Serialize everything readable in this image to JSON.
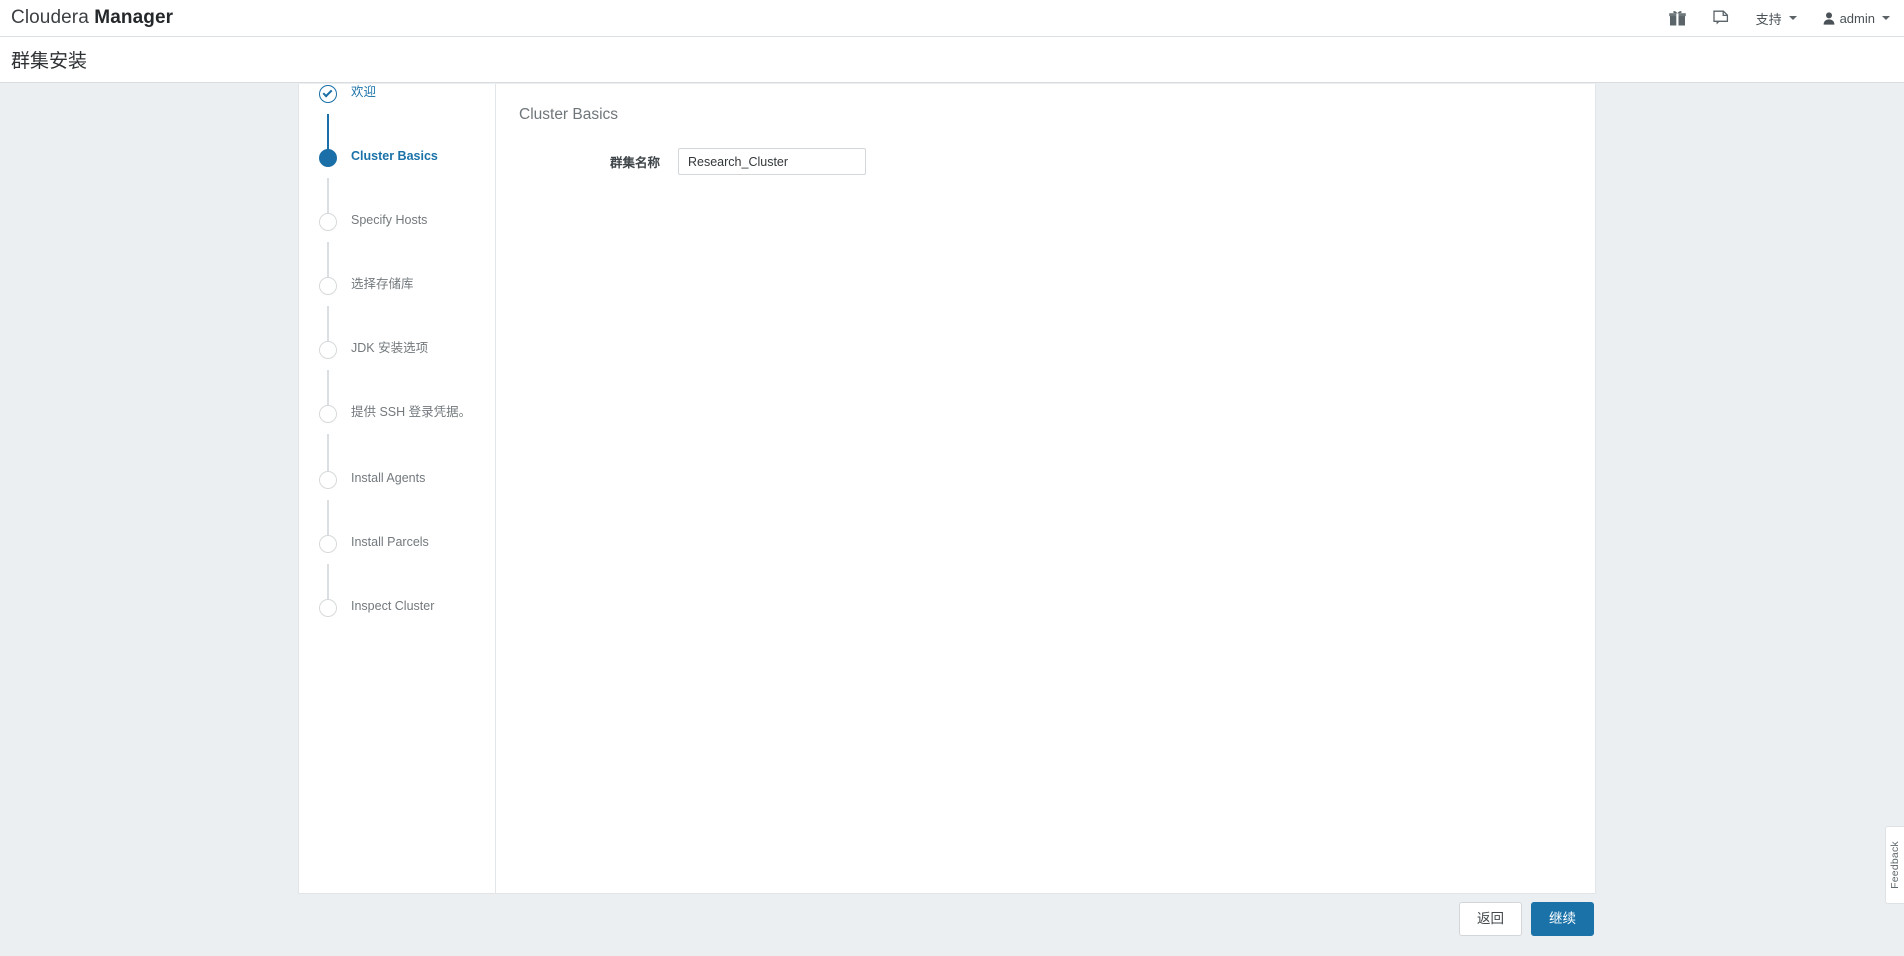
{
  "header": {
    "brand_light": "Cloudera",
    "brand_bold": "Manager",
    "nav": {
      "parcels_icon": "gift-icon",
      "support_doc_icon": "support-doc-icon",
      "support_label": "支持",
      "user_label": "admin"
    }
  },
  "page": {
    "title": "群集安装"
  },
  "wizard": {
    "steps": [
      {
        "label": "欢迎",
        "state": "done"
      },
      {
        "label": "Cluster Basics",
        "state": "current"
      },
      {
        "label": "Specify Hosts",
        "state": "todo"
      },
      {
        "label": "选择存储库",
        "state": "todo"
      },
      {
        "label": "JDK 安装选项",
        "state": "todo"
      },
      {
        "label": "提供 SSH 登录凭据。",
        "state": "todo"
      },
      {
        "label": "Install Agents",
        "state": "todo"
      },
      {
        "label": "Install Parcels",
        "state": "todo"
      },
      {
        "label": "Inspect Cluster",
        "state": "todo"
      }
    ]
  },
  "main": {
    "heading": "Cluster Basics",
    "cluster_name_label": "群集名称",
    "cluster_name_value": "Research_Cluster",
    "cluster_name_placeholder": ""
  },
  "footer": {
    "back_label": "返回",
    "continue_label": "继续"
  },
  "feedback": {
    "label": "Feedback"
  },
  "colors": {
    "accent_blue": "#1a72a8",
    "page_background": "#eceff1",
    "panel_background": "#ffffff",
    "muted_text": "#73797d"
  }
}
